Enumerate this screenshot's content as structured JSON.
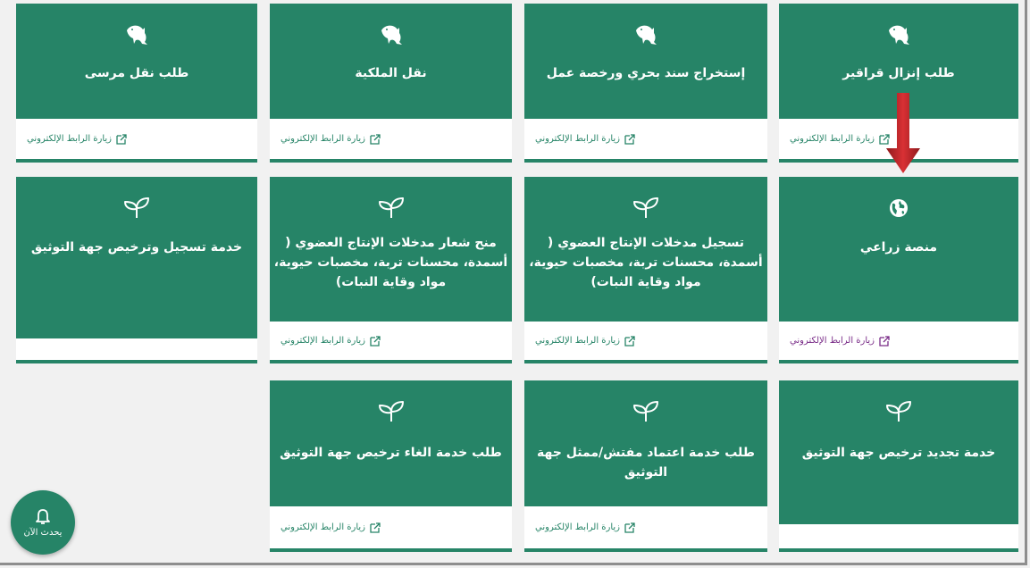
{
  "link_text": "زيارة الرابط الإلكتروني",
  "notify_label": "يحدث الآن",
  "colors": {
    "accent": "#268467",
    "link_visited": "#7a2c88",
    "arrow": "#c0292d"
  },
  "cards": [
    {
      "title": "طلب إنزال قراقير",
      "icon": "dolphin-icon"
    },
    {
      "title": "إستخراج سند بحري ورخصة عمل",
      "icon": "dolphin-icon"
    },
    {
      "title": "نقل الملكية",
      "icon": "dolphin-icon"
    },
    {
      "title": "طلب نقل مرسى",
      "icon": "dolphin-icon"
    },
    {
      "title": "منصة زراعي",
      "icon": "globe-icon"
    },
    {
      "title": "تسجيل مدخلات الإنتاج العضوي ( أسمدة، محسنات تربة، مخصبات حيوية، مواد وقاية النبات)",
      "icon": "sprout-icon"
    },
    {
      "title": "منح شعار مدخلات الإنتاج العضوي ( أسمدة، محسنات تربة، مخصبات حيوية، مواد وقاية النبات)",
      "icon": "sprout-icon"
    },
    {
      "title": "خدمة تسجيل وترخيص جهة التوثيق",
      "icon": "sprout-icon"
    },
    {
      "title": "خدمة تجديد ترخيص جهة التوثيق",
      "icon": "sprout-icon"
    },
    {
      "title": "طلب خدمة اعتماد مفتش/ممثل جهة التوثيق",
      "icon": "sprout-icon"
    },
    {
      "title": "طلب خدمة الغاء ترخيص جهة التوثيق",
      "icon": "sprout-icon"
    }
  ]
}
